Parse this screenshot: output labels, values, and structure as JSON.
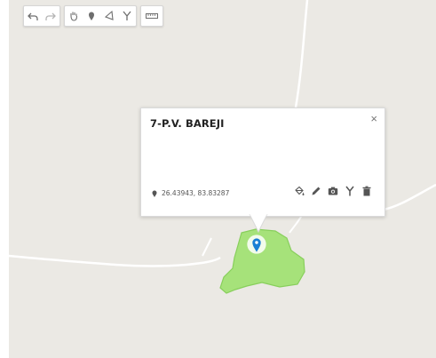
{
  "map": {
    "background": "#ebe9e4",
    "road_color": "#ffffff",
    "polygon_fill": "#a6e27a",
    "polygon_stroke": "#88cf5c"
  },
  "toolbar": {
    "groups": [
      {
        "buttons": [
          {
            "icon": "undo-icon"
          },
          {
            "icon": "redo-icon"
          }
        ]
      },
      {
        "buttons": [
          {
            "icon": "hand-pan-icon"
          },
          {
            "icon": "marker-icon"
          },
          {
            "icon": "polygon-icon"
          },
          {
            "icon": "split-icon"
          }
        ]
      },
      {
        "buttons": [
          {
            "icon": "ruler-icon"
          }
        ]
      }
    ]
  },
  "popup": {
    "title": "7-P.V. BAREJI",
    "close_symbol": "×",
    "coordinates": "26.43943, 83.83287",
    "actions": [
      {
        "icon": "paint-bucket-icon"
      },
      {
        "icon": "pencil-icon"
      },
      {
        "icon": "camera-icon"
      },
      {
        "icon": "split-icon"
      },
      {
        "icon": "trash-icon"
      }
    ]
  },
  "marker": {
    "icon": "location-pin-icon",
    "color": "#1a7fd4"
  }
}
